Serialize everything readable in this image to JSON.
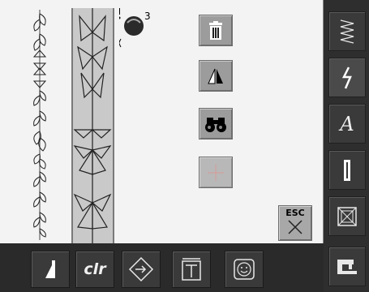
{
  "colors": {
    "canvas_bg": "#f3f3f3",
    "tool_button": "#9c9c9c",
    "sidebar_bg": "#2e2e2e",
    "toolbar_bg": "#2a2a2a"
  },
  "tools": {
    "delete": {
      "icon": "trash-icon"
    },
    "mirror": {
      "icon": "mirror-icon"
    },
    "search": {
      "icon": "binoculars-icon"
    },
    "center": {
      "icon": "crosshair-icon"
    }
  },
  "esc_button": {
    "label": "ESC"
  },
  "sidebar": {
    "items": [
      {
        "icon": "zigzag-stitch-icon"
      },
      {
        "icon": "decorative-stitch-icon"
      },
      {
        "label": "A"
      },
      {
        "icon": "buttonhole-icon"
      },
      {
        "icon": "quilt-stitch-icon"
      },
      {
        "icon": "sewing-machine-icon"
      }
    ]
  },
  "bottombar": {
    "items": [
      {
        "icon": "balance-icon"
      },
      {
        "label": "clr"
      },
      {
        "icon": "rotate-icon"
      },
      {
        "icon": "pattern-end-icon"
      },
      {
        "icon": "personal-program-icon"
      }
    ]
  }
}
